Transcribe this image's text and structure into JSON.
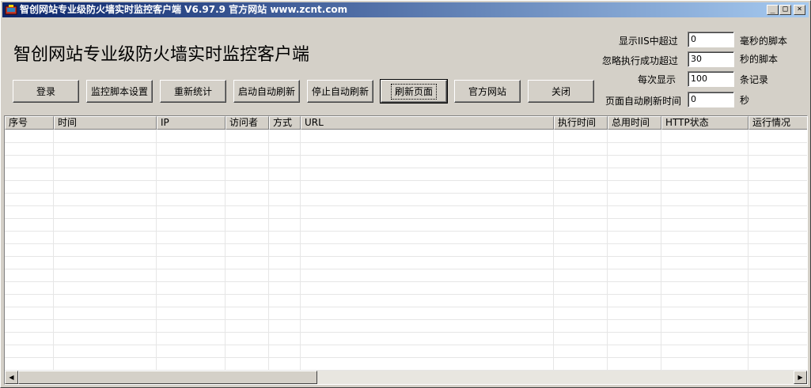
{
  "window": {
    "title": "智创网站专业级防火墙实时监控客户端 V6.97.9 官方网站 www.zcnt.com",
    "minimize": "_",
    "maximize": "□",
    "close": "×"
  },
  "heading": "智创网站专业级防火墙实时监控客户端",
  "toolbar": {
    "login": "登录",
    "monitor_settings": "监控脚本设置",
    "recount": "重新统计",
    "start_auto_refresh": "启动自动刷新",
    "stop_auto_refresh": "停止自动刷新",
    "refresh_page": "刷新页面",
    "official_site": "官方网站",
    "close": "关闭"
  },
  "settings": {
    "iis_threshold_label": "显示IIS中超过",
    "iis_threshold_value": "0",
    "iis_threshold_unit": "毫秒的脚本",
    "ignore_label": "忽略执行成功超过",
    "ignore_value": "30",
    "ignore_unit": "秒的脚本",
    "per_display_label": "每次显示",
    "per_display_value": "100",
    "per_display_unit": "条记录",
    "refresh_interval_label": "页面自动刷新时间",
    "refresh_interval_value": "0",
    "refresh_interval_unit": "秒"
  },
  "table": {
    "columns": [
      "序号",
      "时间",
      "IP",
      "访问者",
      "方式",
      "URL",
      "执行时间",
      "总用时间",
      "HTTP状态",
      "运行情况"
    ],
    "rows": []
  },
  "scrollbar": {
    "left_arrow": "◀",
    "right_arrow": "▶"
  }
}
